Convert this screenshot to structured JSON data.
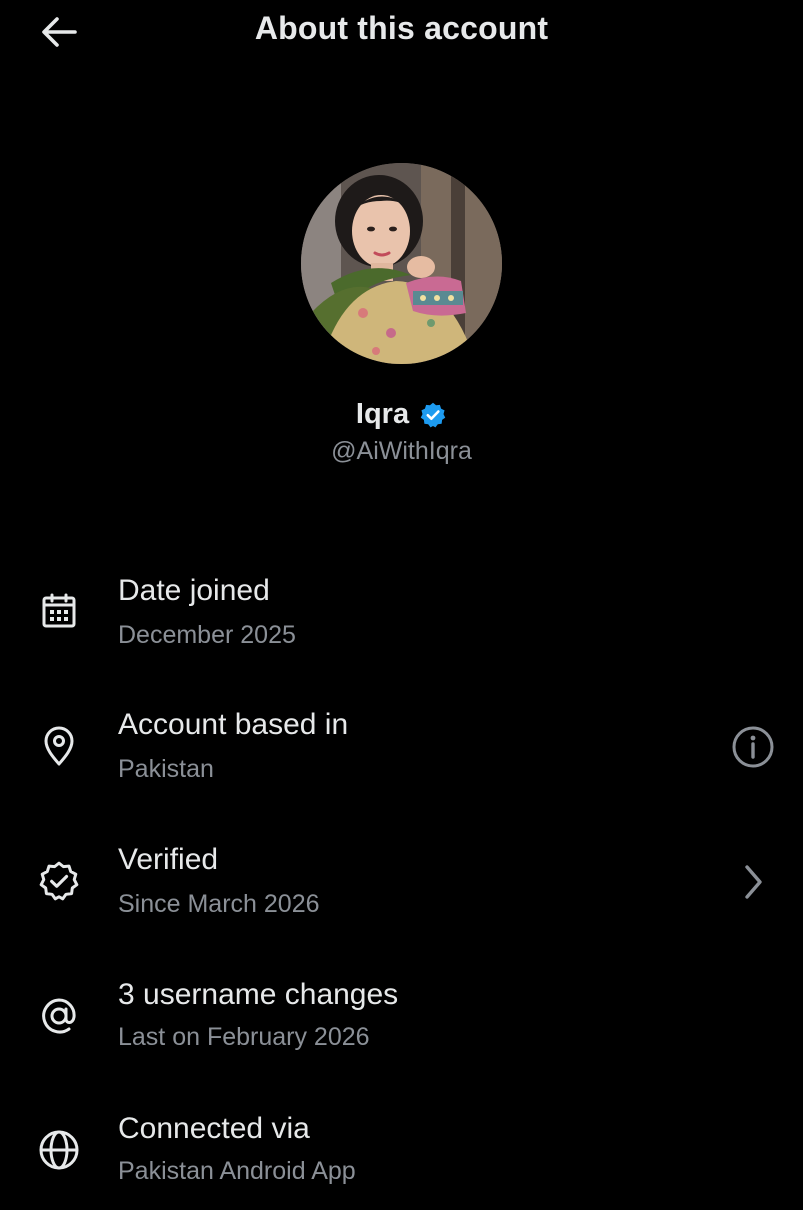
{
  "header": {
    "back_icon": "arrow-left-icon",
    "title": "About this account"
  },
  "profile": {
    "avatar_description": "avatar",
    "name": "Iqra",
    "verified_icon": "verified-badge-icon",
    "verified_color": "#1d9bf0",
    "handle": "@AiWithIqra"
  },
  "details": {
    "date_joined": {
      "icon": "calendar-icon",
      "title": "Date joined",
      "value": "December 2025"
    },
    "account_based_in": {
      "icon": "location-pin-icon",
      "title": "Account based in",
      "value": "Pakistan",
      "trailing_icon": "info-icon"
    },
    "verified": {
      "icon": "verified-check-icon",
      "title": "Verified",
      "value": "Since March 2026",
      "trailing_icon": "chevron-right-icon"
    },
    "username_changes": {
      "icon": "at-sign-icon",
      "title": "3 username changes",
      "value": "Last on February 2026"
    },
    "connected_via": {
      "icon": "globe-icon",
      "title": "Connected via",
      "value": "Pakistan Android App"
    }
  },
  "colors": {
    "background": "#000000",
    "primary_text": "#e7e9ea",
    "secondary_text": "#8b9097",
    "accent": "#1d9bf0"
  }
}
